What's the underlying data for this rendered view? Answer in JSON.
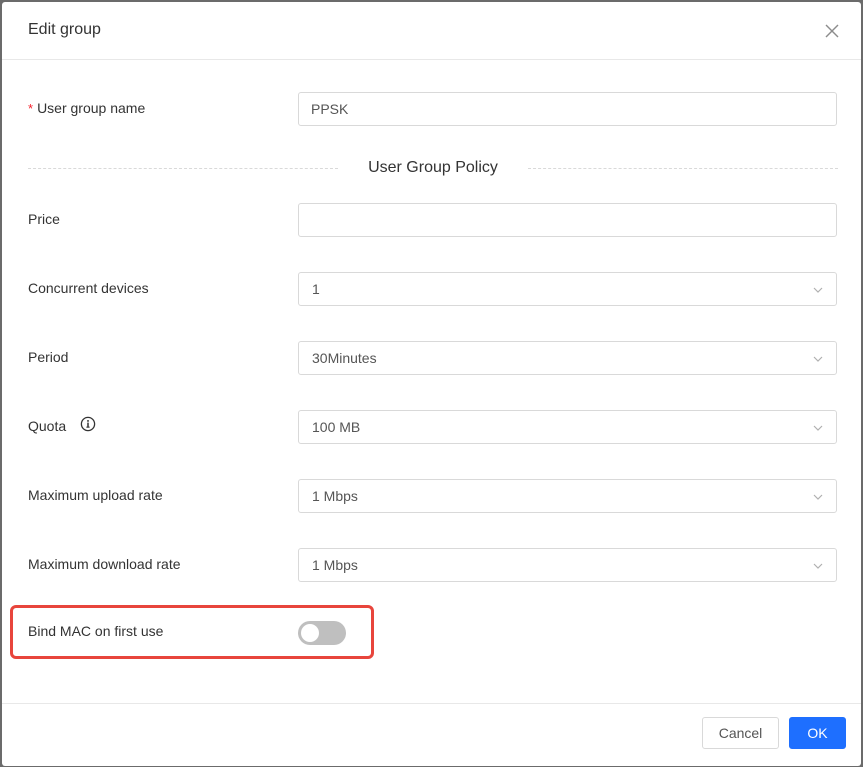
{
  "dialog": {
    "title": "Edit group",
    "close_icon": "close-icon"
  },
  "form": {
    "user_group_name": {
      "required_mark": "*",
      "label": "User group name",
      "value": "PPSK"
    },
    "section_title": "User Group Policy",
    "price": {
      "label": "Price",
      "value": ""
    },
    "concurrent_devices": {
      "label": "Concurrent devices",
      "value": "1"
    },
    "period": {
      "label": "Period",
      "value": "30Minutes"
    },
    "quota": {
      "label": "Quota",
      "info_icon": "info-icon",
      "value": "100 MB"
    },
    "max_upload": {
      "label": "Maximum upload rate",
      "value": "1 Mbps"
    },
    "max_download": {
      "label": "Maximum download rate",
      "value": "1 Mbps"
    },
    "bind_mac": {
      "label": "Bind MAC on first use",
      "enabled": false
    }
  },
  "footer": {
    "cancel_label": "Cancel",
    "ok_label": "OK"
  },
  "colors": {
    "primary": "#1e6fff",
    "highlight": "#e8453c",
    "required": "#f5222d",
    "toggle_off": "#bfbfbf"
  }
}
